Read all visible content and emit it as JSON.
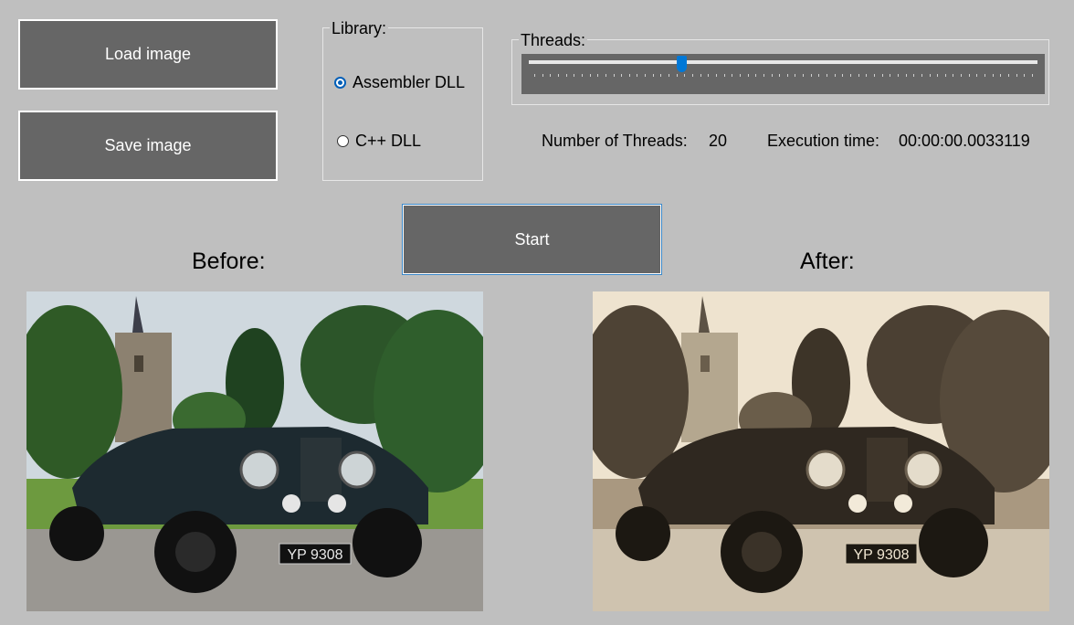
{
  "buttons": {
    "load_label": "Load image",
    "save_label": "Save image",
    "start_label": "Start"
  },
  "library": {
    "title": "Library:",
    "options": [
      {
        "label": "Assembler DLL",
        "checked": true
      },
      {
        "label": "C++ DLL",
        "checked": false
      }
    ]
  },
  "threads": {
    "title": "Threads:",
    "slider_min": 1,
    "slider_max": 64,
    "slider_value": 20,
    "count_label": "Number of Threads:",
    "count_value": "20"
  },
  "execution": {
    "label": "Execution time:",
    "value": "00:00:00.0033119"
  },
  "images": {
    "before_caption": "Before:",
    "after_caption": "After:",
    "plate_text": "YP 9308"
  },
  "colors": {
    "background": "#bfbfbf",
    "button": "#666666",
    "accent": "#0078d7",
    "sepia_tint": "#d9c6a4"
  }
}
